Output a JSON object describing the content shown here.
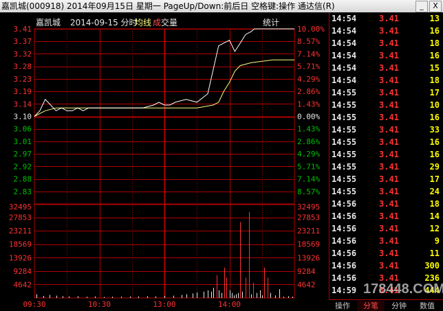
{
  "window": {
    "title": "嘉凯城(000918) 2014年09月15日 星期一 PageUp/Down:前后日 空格键:操作 通达信(R)",
    "minimize_glyph": "_",
    "close_glyph": "X"
  },
  "header": {
    "stock_name": "嘉凯城",
    "date_label": "2014-09-15 分时",
    "avg_label": "均线",
    "vol_prefix": "成",
    "vol_label": "交量",
    "stats_button": "统计"
  },
  "colors": {
    "grid": "#b00000",
    "price_line": "#ffffff",
    "avg_line": "#ffff80",
    "up_text": "#ff3232",
    "down_text": "#00c000",
    "volume_bar": "#ff3232"
  },
  "chart_data": {
    "type": "line",
    "title": "",
    "x_ticks": [
      "09:30",
      "10:30",
      "13:00",
      "14:00"
    ],
    "y_price_ticks": [
      "3.41",
      "3.37",
      "3.32",
      "3.28",
      "3.23",
      "3.19",
      "3.14",
      "3.10",
      "3.06",
      "3.01",
      "2.97",
      "2.92",
      "2.88",
      "2.83"
    ],
    "y_pct_ticks": [
      "10.00%",
      "8.57%",
      "7.14%",
      "5.71%",
      "4.29%",
      "2.86%",
      "1.43%",
      "0.00%",
      "1.43%",
      "2.86%",
      "4.29%",
      "5.71%",
      "7.14%",
      "8.57%"
    ],
    "y_vol_ticks": [
      "32495",
      "27853",
      "23211",
      "18569",
      "13926",
      "9284",
      "4642"
    ],
    "prev_close": 3.1,
    "price_range": [
      2.79,
      3.41
    ],
    "volume_range": [
      0,
      37137
    ],
    "series": [
      {
        "kind": "price",
        "x": [
          0,
          5,
          10,
          15,
          20,
          25,
          30,
          35,
          40,
          45,
          50,
          55,
          60,
          70,
          80,
          90,
          100,
          110,
          115,
          120,
          125,
          130,
          140,
          150,
          160,
          170,
          180,
          185,
          190,
          195,
          200,
          203,
          205,
          208,
          210,
          213,
          215,
          220,
          225,
          240
        ],
        "values": [
          3.1,
          3.12,
          3.16,
          3.14,
          3.12,
          3.13,
          3.12,
          3.12,
          3.13,
          3.12,
          3.13,
          3.13,
          3.13,
          3.13,
          3.13,
          3.13,
          3.13,
          3.14,
          3.15,
          3.14,
          3.14,
          3.15,
          3.16,
          3.15,
          3.18,
          3.35,
          3.37,
          3.33,
          3.36,
          3.39,
          3.4,
          3.41,
          3.41,
          3.41,
          3.41,
          3.41,
          3.41,
          3.41,
          3.41,
          3.41
        ]
      },
      {
        "kind": "avg",
        "x": [
          0,
          10,
          20,
          30,
          60,
          90,
          120,
          150,
          165,
          170,
          175,
          180,
          185,
          190,
          200,
          210,
          220,
          230,
          240
        ],
        "values": [
          3.1,
          3.12,
          3.13,
          3.13,
          3.13,
          3.13,
          3.13,
          3.13,
          3.14,
          3.15,
          3.19,
          3.22,
          3.26,
          3.28,
          3.29,
          3.295,
          3.3,
          3.3,
          3.3
        ]
      }
    ],
    "volume": {
      "x": [
        2,
        8,
        14,
        20,
        26,
        32,
        40,
        48,
        56,
        64,
        72,
        80,
        88,
        96,
        104,
        112,
        120,
        128,
        136,
        140,
        146,
        150,
        156,
        160,
        163,
        165,
        168,
        170,
        173,
        175,
        177,
        180,
        182,
        184,
        186,
        188,
        190,
        192,
        195,
        198,
        200,
        202,
        205,
        208,
        210,
        212,
        215,
        218,
        222,
        226,
        230,
        234,
        238
      ],
      "values": [
        1500,
        800,
        1200,
        900,
        700,
        600,
        700,
        500,
        600,
        400,
        500,
        500,
        600,
        600,
        700,
        600,
        800,
        900,
        1200,
        1500,
        1800,
        2200,
        2500,
        3000,
        2500,
        4000,
        9000,
        3000,
        2000,
        12000,
        8000,
        3000,
        2000,
        1000,
        1500,
        2000,
        30000,
        2500,
        8000,
        34000,
        1500,
        6000,
        2000,
        3000,
        1000,
        12000,
        8000,
        2000,
        1000,
        3500,
        500,
        700,
        500
      ]
    }
  },
  "ticks": [
    {
      "time": "14:54",
      "price": "3.41",
      "vol": "13"
    },
    {
      "time": "14:54",
      "price": "3.41",
      "vol": "16"
    },
    {
      "time": "14:54",
      "price": "3.41",
      "vol": "18"
    },
    {
      "time": "14:54",
      "price": "3.41",
      "vol": "16"
    },
    {
      "time": "14:54",
      "price": "3.41",
      "vol": "15"
    },
    {
      "time": "14:54",
      "price": "3.41",
      "vol": "18"
    },
    {
      "time": "14:55",
      "price": "3.41",
      "vol": "17"
    },
    {
      "time": "14:55",
      "price": "3.41",
      "vol": "10"
    },
    {
      "time": "14:55",
      "price": "3.41",
      "vol": "16"
    },
    {
      "time": "14:55",
      "price": "3.41",
      "vol": "33"
    },
    {
      "time": "14:55",
      "price": "3.41",
      "vol": "16"
    },
    {
      "time": "14:55",
      "price": "3.41",
      "vol": "16"
    },
    {
      "time": "14:55",
      "price": "3.41",
      "vol": "29"
    },
    {
      "time": "14:55",
      "price": "3.41",
      "vol": "17"
    },
    {
      "time": "14:55",
      "price": "3.41",
      "vol": "24"
    },
    {
      "time": "14:56",
      "price": "3.41",
      "vol": "18"
    },
    {
      "time": "14:56",
      "price": "3.41",
      "vol": "14"
    },
    {
      "time": "14:56",
      "price": "3.41",
      "vol": "12"
    },
    {
      "time": "14:56",
      "price": "3.41",
      "vol": "9"
    },
    {
      "time": "14:56",
      "price": "3.41",
      "vol": "11"
    },
    {
      "time": "14:56",
      "price": "3.41",
      "vol": "300"
    },
    {
      "time": "14:56",
      "price": "3.41",
      "vol": "236"
    },
    {
      "time": "14:59",
      "price": "3.41",
      "vol": "444"
    }
  ],
  "tabs": [
    {
      "label": "操作",
      "active": false
    },
    {
      "label": "分笔",
      "active": true
    },
    {
      "label": "分钟",
      "active": false
    },
    {
      "label": "数值",
      "active": false
    }
  ],
  "watermark": "178448.COM"
}
